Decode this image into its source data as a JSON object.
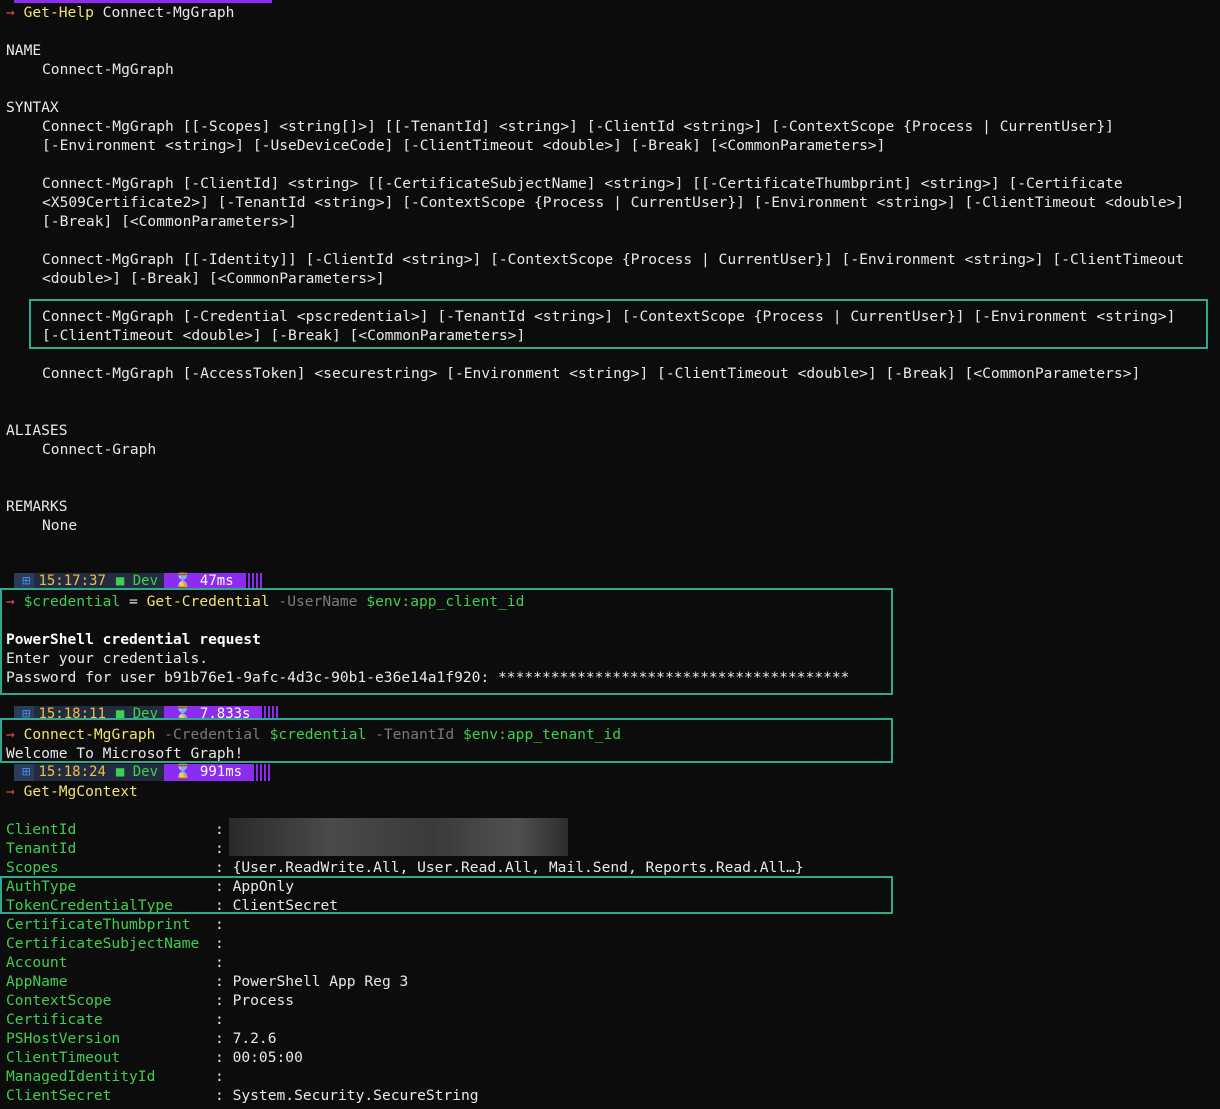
{
  "prompt_arrow": "→",
  "cmd1": {
    "cmdlet": "Get-Help",
    "arg": " Connect-MgGraph"
  },
  "help": {
    "name_header": "NAME",
    "name_value": "Connect-MgGraph",
    "syntax_header": "SYNTAX",
    "syntax_lines": [
      "Connect-MgGraph [[-Scopes] <string[]>] [[-TenantId] <string>] [-ClientId <string>] [-ContextScope {Process | CurrentUser}]",
      "[-Environment <string>] [-UseDeviceCode] [-ClientTimeout <double>] [-Break] [<CommonParameters>]",
      "Connect-MgGraph [-ClientId] <string> [[-CertificateSubjectName] <string>] [[-CertificateThumbprint] <string>] [-Certificate",
      "<X509Certificate2>] [-TenantId <string>] [-ContextScope {Process | CurrentUser}] [-Environment <string>] [-ClientTimeout <double>]",
      "[-Break] [<CommonParameters>]",
      "Connect-MgGraph [[-Identity]] [-ClientId <string>] [-ContextScope {Process | CurrentUser}] [-Environment <string>] [-ClientTimeout",
      "<double>] [-Break] [<CommonParameters>]",
      "Connect-MgGraph [-Credential <pscredential>] [-TenantId <string>] [-ContextScope {Process | CurrentUser}] [-Environment <string>]",
      "[-ClientTimeout <double>] [-Break] [<CommonParameters>]",
      "Connect-MgGraph [-AccessToken] <securestring> [-Environment <string>] [-ClientTimeout <double>] [-Break] [<CommonParameters>]"
    ],
    "aliases_header": "ALIASES",
    "aliases_value": "Connect-Graph",
    "remarks_header": "REMARKS",
    "remarks_value": "None"
  },
  "prompts": [
    {
      "time": "15:17:37",
      "dir": "Dev",
      "duration": "47ms"
    },
    {
      "time": "15:18:11",
      "dir": "Dev",
      "duration": "7.833s"
    },
    {
      "time": "15:18:24",
      "dir": "Dev",
      "duration": "991ms"
    }
  ],
  "prompt_icons": {
    "os": "windows-icon",
    "folder": "folder-icon",
    "timer": "hourglass-icon"
  },
  "cmd2": {
    "var": "$credential",
    "eq": " = ",
    "cmdlet": "Get-Credential",
    "param": " -UserName ",
    "val": "$env:app_client_id"
  },
  "cred_output": {
    "title": "PowerShell credential request",
    "line2": "Enter your credentials.",
    "line3": "Password for user b91b76e1-9afc-4d3c-90b1-e36e14a1f920: ****************************************"
  },
  "cmd3": {
    "cmdlet": "Connect-MgGraph",
    "p1": " -Credential ",
    "v1": "$credential",
    "p2": " -TenantId ",
    "v2": "$env:app_tenant_id"
  },
  "welcome": "Welcome To Microsoft Graph!",
  "cmd4": {
    "cmdlet": "Get-MgContext"
  },
  "context": [
    {
      "key": "ClientId",
      "value": ""
    },
    {
      "key": "TenantId",
      "value": ""
    },
    {
      "key": "Scopes",
      "value": "{User.ReadWrite.All, User.Read.All, Mail.Send, Reports.Read.All…}"
    },
    {
      "key": "AuthType",
      "value": "AppOnly"
    },
    {
      "key": "TokenCredentialType",
      "value": "ClientSecret"
    },
    {
      "key": "CertificateThumbprint",
      "value": ""
    },
    {
      "key": "CertificateSubjectName",
      "value": ""
    },
    {
      "key": "Account",
      "value": ""
    },
    {
      "key": "AppName",
      "value": "PowerShell App Reg 3"
    },
    {
      "key": "ContextScope",
      "value": "Process"
    },
    {
      "key": "Certificate",
      "value": ""
    },
    {
      "key": "PSHostVersion",
      "value": "7.2.6"
    },
    {
      "key": "ClientTimeout",
      "value": "00:05:00"
    },
    {
      "key": "ManagedIdentityId",
      "value": ""
    },
    {
      "key": "ClientSecret",
      "value": "System.Security.SecureString"
    }
  ],
  "separator": ": ",
  "colors": {
    "background": "#0c0c0c",
    "highlight_box": "#2fa88e",
    "prompt_accent": "#8b2cf0",
    "key_green": "#3fcf4e",
    "cmdlet_yellow": "#f2e36b"
  }
}
